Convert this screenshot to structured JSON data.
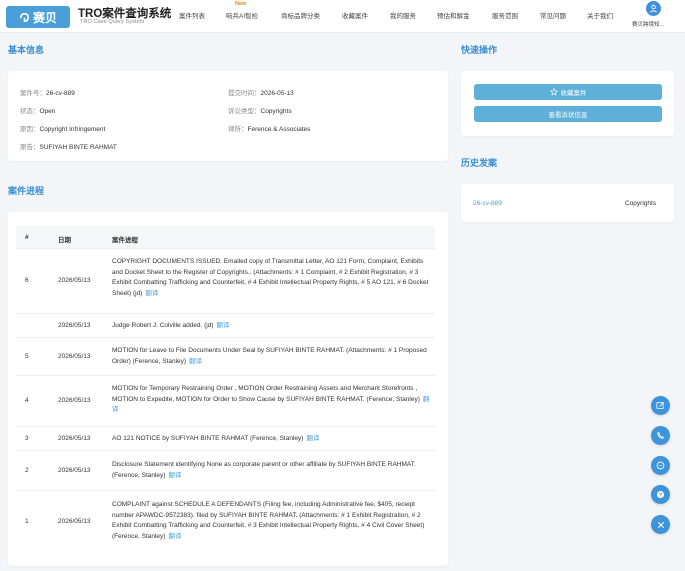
{
  "header": {
    "logo_text": "赛贝",
    "title": "TRO案件查询系统",
    "subtitle": "TRO Case Query System",
    "nav": [
      {
        "label": "案件列表"
      },
      {
        "label": "响兵AI智检",
        "badge": "New"
      },
      {
        "label": "商标品牌分类"
      },
      {
        "label": "收藏案件"
      },
      {
        "label": "我的服务"
      },
      {
        "label": "预估和解金"
      },
      {
        "label": "服务范围"
      },
      {
        "label": "常见问题"
      },
      {
        "label": "关于我们"
      }
    ],
    "user_name": "赛贝跨境知..."
  },
  "basic_info": {
    "title": "基本信息",
    "case_no_label": "案件号：",
    "case_no": "26-cv-889",
    "filed_label": "提交时间：",
    "filed": "2026-05-13",
    "status_label": "状态：",
    "status": "Open",
    "type_label": "诉讼类型：",
    "type": "Copyrights",
    "cause_label": "原因：",
    "cause": "Copyright Infringement",
    "lawyer_label": "律所：",
    "lawyer": "Ference & Associates",
    "plaintiff_label": "原告：",
    "plaintiff": "SUFIYAH BINTE RAHMAT"
  },
  "quick_actions": {
    "title": "快速操作",
    "favorite": "收藏案件",
    "view_complaint": "查看诉状信息"
  },
  "history": {
    "title": "历史发案",
    "items": [
      {
        "case": "26-cv-889",
        "type": "Copyrights"
      }
    ]
  },
  "progress": {
    "title": "案件进程",
    "col_no": "#",
    "col_date": "日期",
    "col_text": "案件进程",
    "translate_label": "翻译",
    "rows": [
      {
        "no": "6",
        "date": "2026/05/13",
        "text": "COPYRIGHT DOCUMENTS ISSUED. Emailed copy of Transmittal Letter, AO 121 Form, Complaint, Exhibits and Docket Sheet to the Register of Copyrights.. (Attachments: # 1 Complaint, # 2 Exhibit Registration, # 3 Exhibit Combatting Trafficking and Counterfeit, # 4 Exhibit Intellectual Property Rights, # 5 AO 121, # 6 Docket Sheet) (jd)"
      },
      {
        "no": "",
        "date": "2026/05/13",
        "text": "Judge Robert J. Colville added. (jd)"
      },
      {
        "no": "5",
        "date": "2026/05/13",
        "text": "MOTION for Leave to File Documents Under Seal by SUFIYAH BINTE RAHMAT. (Attachments: # 1 Proposed Order) (Ference, Stanley)"
      },
      {
        "no": "4",
        "date": "2026/05/13",
        "text": "MOTION for Temporary Restraining Order , MOTION Order Restraining Assets and Merchant Storefronts , MOTION to Expedite, MOTION for Order to Show Cause by SUFIYAH BINTE RAHMAT. (Ference, Stanley)"
      },
      {
        "no": "3",
        "date": "2026/05/13",
        "text": "AO 121 NOTICE by SUFIYAH BINTE RAHMAT (Ference, Stanley)"
      },
      {
        "no": "2",
        "date": "2026/05/13",
        "text": "Disclosure Statement identifying None as corporate parent or other affiliate by SUFIYAH BINTE RAHMAT. (Ference, Stanley)"
      },
      {
        "no": "1",
        "date": "2026/05/13",
        "text": "COMPLAINT against SCHEDULE A DEFENDANTS (Filing fee, including Administrative fee, $405, receipt number APAWDC-9572383). filed by SUFIYAH BINTE RAHMAT. (Attachments: # 1 Exhibit Registration, # 2 Exhibit Combatting Trafficking and Counterfeit, # 3 Exhibit Intellectual Property Rights, # 4 Civil Cover Sheet) (Ference, Stanley)"
      }
    ]
  },
  "floating_buttons": [
    "edit-icon",
    "phone-icon",
    "chat-icon",
    "help-icon",
    "close-icon"
  ],
  "colors": {
    "accent": "#3b8fd2",
    "button": "#5eb0d9",
    "float": "#3d94d8"
  }
}
